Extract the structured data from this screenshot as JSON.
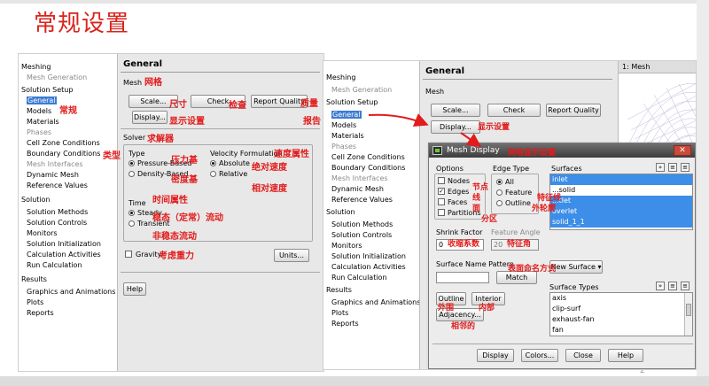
{
  "slide": {
    "title": "常规设置",
    "page_number": "2"
  },
  "left": {
    "tree": [
      {
        "label": "Meshing",
        "kind": "header"
      },
      {
        "label": "Mesh Generation",
        "kind": "sub-gray"
      },
      {
        "label": "Solution Setup",
        "kind": "header"
      },
      {
        "label": "General",
        "kind": "sub-selected"
      },
      {
        "label": "Models",
        "kind": "sub"
      },
      {
        "label": "Materials",
        "kind": "sub"
      },
      {
        "label": "Phases",
        "kind": "sub-gray"
      },
      {
        "label": "Cell Zone Conditions",
        "kind": "sub"
      },
      {
        "label": "Boundary Conditions",
        "kind": "sub"
      },
      {
        "label": "Mesh Interfaces",
        "kind": "sub-gray"
      },
      {
        "label": "Dynamic Mesh",
        "kind": "sub"
      },
      {
        "label": "Reference Values",
        "kind": "sub"
      },
      {
        "label": "Solution",
        "kind": "header"
      },
      {
        "label": "Solution Methods",
        "kind": "sub"
      },
      {
        "label": "Solution Controls",
        "kind": "sub"
      },
      {
        "label": "Monitors",
        "kind": "sub"
      },
      {
        "label": "Solution Initialization",
        "kind": "sub"
      },
      {
        "label": "Calculation Activities",
        "kind": "sub"
      },
      {
        "label": "Run Calculation",
        "kind": "sub"
      },
      {
        "label": "Results",
        "kind": "header"
      },
      {
        "label": "Graphics and Animations",
        "kind": "sub"
      },
      {
        "label": "Plots",
        "kind": "sub"
      },
      {
        "label": "Reports",
        "kind": "sub"
      }
    ],
    "panel": {
      "title": "General",
      "mesh_label": "Mesh",
      "scale_btn": "Scale...",
      "check_btn": "Check",
      "report_quality_btn": "Report Quality",
      "display_btn": "Display...",
      "solver_label": "Solver",
      "type_label": "Type",
      "pressure_based": "Pressure-Based",
      "density_based": "Density-Based",
      "velocity_label": "Velocity Formulation",
      "absolute": "Absolute",
      "relative": "Relative",
      "time_label": "Time",
      "steady": "Steady",
      "transient": "Transient",
      "gravity": "Gravity",
      "units_btn": "Units...",
      "help_btn": "Help"
    },
    "annotations": {
      "general": "常规",
      "mesh": "网格",
      "scale": "尺寸",
      "check": "检查",
      "quality": "质量",
      "display": "显示设置",
      "report": "报告",
      "solver": "求解器",
      "type": "类型",
      "pressure": "压力基",
      "density": "密度基",
      "velocity": "速度属性",
      "absolute": "绝对速度",
      "relative": "相对速度",
      "time": "时间属性",
      "steady": "稳态（定常）流动",
      "transient": "非稳态流动",
      "gravity": "考虑重力"
    }
  },
  "right": {
    "tree": [
      {
        "label": "Meshing",
        "kind": "header"
      },
      {
        "label": "Mesh Generation",
        "kind": "sub-gray"
      },
      {
        "label": "Solution Setup",
        "kind": "header"
      },
      {
        "label": "General",
        "kind": "sub-selected"
      },
      {
        "label": "Models",
        "kind": "sub"
      },
      {
        "label": "Materials",
        "kind": "sub"
      },
      {
        "label": "Phases",
        "kind": "sub-gray"
      },
      {
        "label": "Cell Zone Conditions",
        "kind": "sub"
      },
      {
        "label": "Boundary Conditions",
        "kind": "sub"
      },
      {
        "label": "Mesh Interfaces",
        "kind": "sub-gray"
      },
      {
        "label": "Dynamic Mesh",
        "kind": "sub"
      },
      {
        "label": "Reference Values",
        "kind": "sub"
      },
      {
        "label": "Solution",
        "kind": "header"
      },
      {
        "label": "Solution Methods",
        "kind": "sub"
      },
      {
        "label": "Solution Controls",
        "kind": "sub"
      },
      {
        "label": "Monitors",
        "kind": "sub"
      },
      {
        "label": "Solution Initialization",
        "kind": "sub"
      },
      {
        "label": "Calculation Activities",
        "kind": "sub"
      },
      {
        "label": "Run Calculation",
        "kind": "sub"
      },
      {
        "label": "Results",
        "kind": "header"
      },
      {
        "label": "Graphics and Animations",
        "kind": "sub"
      },
      {
        "label": "Plots",
        "kind": "sub"
      },
      {
        "label": "Reports",
        "kind": "sub"
      }
    ],
    "panel": {
      "title": "General",
      "mesh_label": "Mesh",
      "scale_btn": "Scale...",
      "check_btn": "Check",
      "report_quality_btn": "Report Quality",
      "display_btn": "Display..."
    },
    "mesh_window_title": "1: Mesh",
    "dialog": {
      "title": "Mesh Display",
      "options_label": "Options",
      "nodes": "Nodes",
      "edges": "Edges",
      "faces": "Faces",
      "partitions": "Partitions",
      "edge_type_label": "Edge Type",
      "all": "All",
      "feature": "Feature",
      "outline": "Outline",
      "surfaces_label": "Surfaces",
      "surfaces": [
        {
          "label": "inlet",
          "selected": true
        },
        {
          "label": "...solid",
          "selected": false
        },
        {
          "label": "...tlet",
          "selected": true
        },
        {
          "label": "overlet",
          "selected": true
        },
        {
          "label": "solid_1_1",
          "selected": true
        }
      ],
      "shrink_label": "Shrink Factor",
      "shrink_value": "0",
      "angle_label": "Feature Angle",
      "angle_value": "20",
      "pattern_label": "Surface Name Pattern",
      "match_btn": "Match",
      "new_surface_btn": "New Surface ▾",
      "outline_btn": "Outline",
      "interior_btn": "Interior",
      "adjacency_btn": "Adjacency...",
      "surface_types_label": "Surface Types",
      "surface_types": [
        "axis",
        "clip-surf",
        "exhaust-fan",
        "fan"
      ],
      "display_btn": "Display",
      "colors_btn": "Colors...",
      "close_btn": "Close",
      "help_btn": "Help"
    },
    "annotations": {
      "display": "显示设置",
      "mesh_display": "网格显示设置",
      "nodes": "节点",
      "edges": "线",
      "faces": "面",
      "partitions": "分区",
      "feature": "特征线",
      "outline": "外轮廓",
      "shrink": "收缩系数",
      "angle": "特征角",
      "pattern": "表面命名方式",
      "outline_btn": "外围",
      "interior_btn": "内部",
      "adjacency": "相邻的"
    }
  },
  "colors": {
    "annotation": "#e21b1b",
    "selection": "#3c7bd0",
    "list_selection": "#3c8ee8"
  }
}
